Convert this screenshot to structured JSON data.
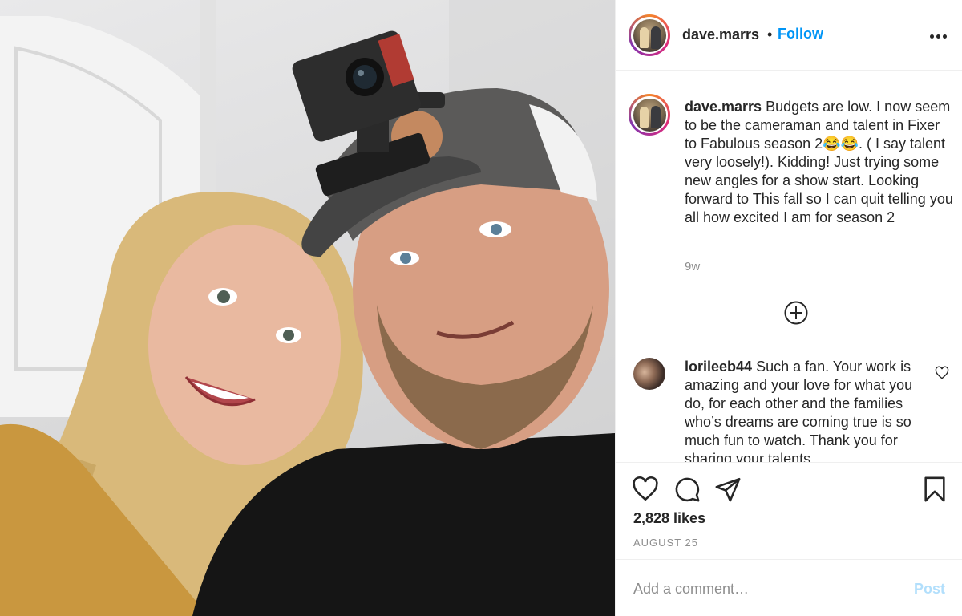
{
  "post": {
    "username": "dave.marrs",
    "separator": "•",
    "follow_label": "Follow",
    "caption_user": "dave.marrs",
    "caption": "Budgets are low. I now seem to be the cameraman and talent in Fixer to Fabulous season 2😂😂. ( I say talent very loosely!). Kidding! Just trying some new angles for a show start. Looking forward to This fall so I can quit telling you all how excited I am for season 2",
    "time_ago": "9w",
    "likes": "2,828 likes",
    "date": "AUGUST 25"
  },
  "comments": [
    {
      "username": "lorileeb44",
      "text": "Such a fan. Your work is amazing and your love for what you do, for each other and the families who’s dreams are coming true is so much fun to watch. Thank you for sharing your talents"
    }
  ],
  "add_comment": {
    "placeholder": "Add a comment…",
    "post_label": "Post"
  },
  "icons": {
    "more": "more-options-icon",
    "load_more": "plus-circle-icon",
    "like": "heart-icon",
    "comment": "speech-bubble-icon",
    "share": "paper-plane-icon",
    "save": "bookmark-icon"
  },
  "colors": {
    "follow": "#0095f6",
    "post_disabled": "#b2dffc",
    "muted": "#8e8e8e",
    "text": "#262626"
  }
}
